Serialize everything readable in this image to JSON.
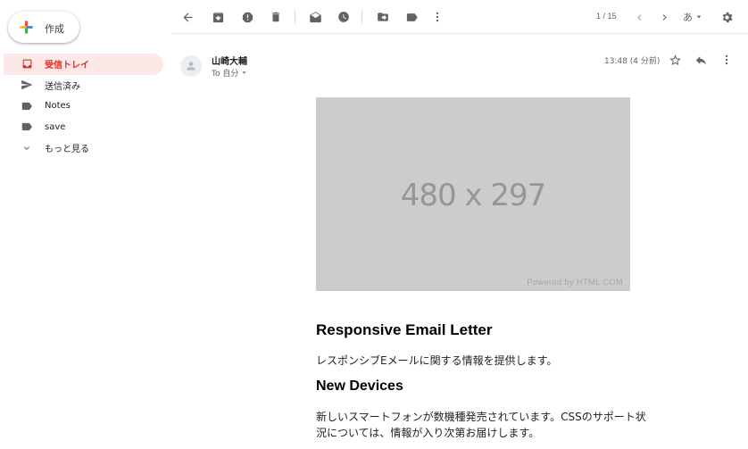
{
  "sidebar": {
    "compose_label": "作成",
    "items": [
      {
        "label": "受信トレイ",
        "icon": "inbox-icon"
      },
      {
        "label": "送信済み",
        "icon": "send-icon"
      },
      {
        "label": "Notes",
        "icon": "label-icon"
      },
      {
        "label": "save",
        "icon": "label-icon"
      },
      {
        "label": "もっと見る",
        "icon": "chevron-down-icon"
      }
    ]
  },
  "toolbar": {
    "pager": "1 / 15",
    "input_lang": "あ"
  },
  "message": {
    "sender": "山崎大輔",
    "to_line": "To 自分",
    "time": "13:48 (4 分前)",
    "image": {
      "dimensions": "480 x 297",
      "powered_by": "Powered by HTML.COM"
    },
    "heading1": "Responsive Email Letter",
    "para1": "レスポンシブEメールに関する情報を提供します。",
    "heading2": "New Devices",
    "para2": "新しいスマートフォンが数機種発売されています。CSSのサポート状況については、情報が入り次第お届けします。"
  },
  "colors": {
    "accent": "#d93025",
    "active_bg": "#fce8e6",
    "icon": "#5f6368"
  }
}
